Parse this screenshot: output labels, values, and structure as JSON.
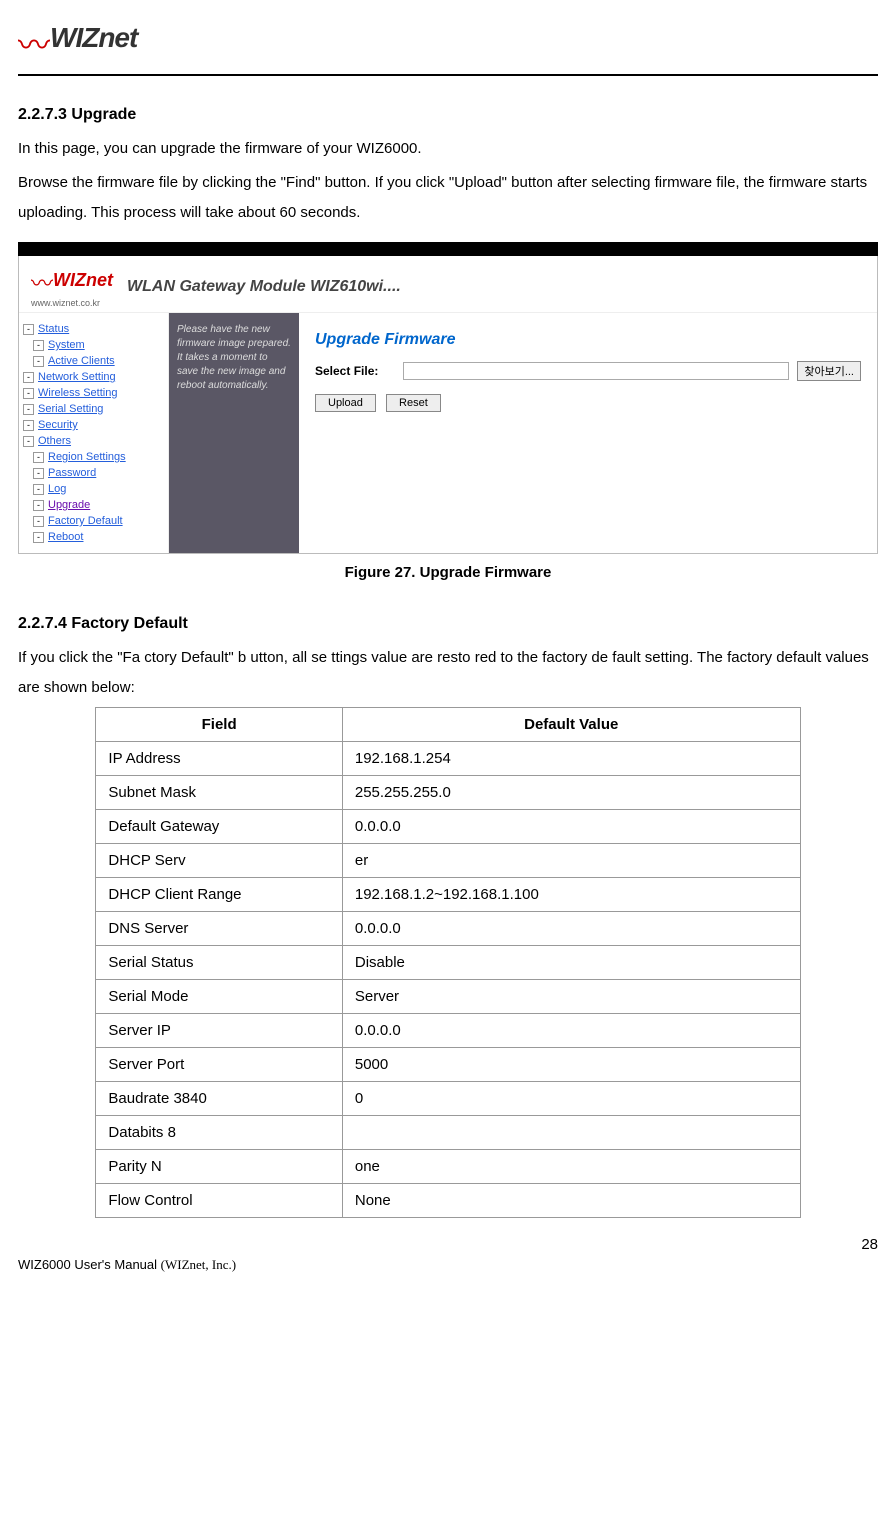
{
  "logo": {
    "text": "WIZnet"
  },
  "section1": {
    "number": "2.2.7.3",
    "title": "Upgrade",
    "para1": "In this page, you can upgrade the firmware of your WIZ6000.",
    "para2": "Browse the firmware file by clicking the \"Find\" button. If you click \"Upload\" button after selecting firmware file, the firmware starts uploading. This process will take about   60 seconds."
  },
  "screenshot": {
    "logo_brand": "WIZnet",
    "logo_url": "www.wiznet.co.kr",
    "header_title": "WLAN Gateway Module WIZ610wi....",
    "sidebar": [
      {
        "label": "Status",
        "nested": false
      },
      {
        "label": "System",
        "nested": true
      },
      {
        "label": "Active Clients",
        "nested": true
      },
      {
        "label": "Network Setting",
        "nested": false
      },
      {
        "label": "Wireless Setting",
        "nested": false
      },
      {
        "label": "Serial Setting",
        "nested": false
      },
      {
        "label": "Security",
        "nested": false
      },
      {
        "label": "Others",
        "nested": false
      },
      {
        "label": "Region Settings",
        "nested": true
      },
      {
        "label": "Password",
        "nested": true
      },
      {
        "label": "Log",
        "nested": true
      },
      {
        "label": "Upgrade",
        "nested": true,
        "current": true
      },
      {
        "label": "Factory Default",
        "nested": true
      },
      {
        "label": "Reboot",
        "nested": true
      }
    ],
    "tip_text": "Please have the new firmware image prepared. It takes a moment to save the new image and reboot automatically.",
    "main_title": "Upgrade Firmware",
    "field_label": "Select File:",
    "browse_label": "찾아보기...",
    "upload_btn": "Upload",
    "reset_btn": "Reset"
  },
  "figure_caption": "Figure 27. Upgrade Firmware",
  "section2": {
    "number": "2.2.7.4",
    "title": "Factory Default",
    "para": "If you click the \"Fa  ctory  Default\" b utton, all se ttings value are  resto red to the factory de  fault setting.   The factory default values are shown below:"
  },
  "table": {
    "headers": {
      "field": "Field",
      "value": "Default Value"
    },
    "rows": [
      {
        "field": "IP Address",
        "value": "192.168.1.254"
      },
      {
        "field": "Subnet Mask",
        "value": "255.255.255.0"
      },
      {
        "field": "Default Gateway",
        "value": "0.0.0.0"
      },
      {
        "field": "DHCP Serv",
        "value": "       er"
      },
      {
        "field": "DHCP Client Range",
        "value": "192.168.1.2~192.168.1.100"
      },
      {
        "field": "DNS Server",
        "value": "0.0.0.0"
      },
      {
        "field": "Serial Status",
        "value": "Disable"
      },
      {
        "field": "Serial Mode",
        "value": "Server"
      },
      {
        "field": "Server IP",
        "value": "0.0.0.0"
      },
      {
        "field": "Server Port",
        "value": "5000"
      },
      {
        "field": "Baudrate 3840",
        "value": "       0"
      },
      {
        "field": "Databits 8",
        "value": ""
      },
      {
        "field": "Parity N",
        "value": "  one"
      },
      {
        "field": "Flow Control",
        "value": "None"
      }
    ]
  },
  "page_number": "28",
  "footer": {
    "manual": "WIZ6000 User's Manual",
    "company": "(WIZnet, Inc.)"
  }
}
